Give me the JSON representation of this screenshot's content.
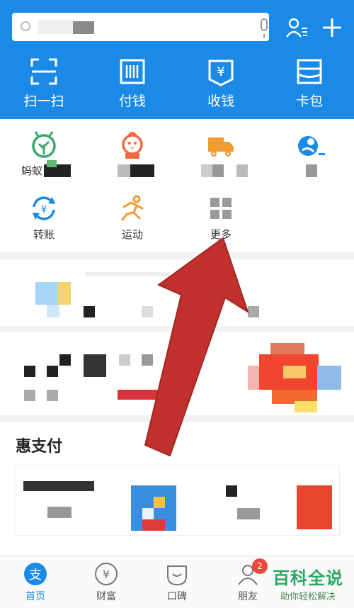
{
  "header": {
    "quick_actions": [
      {
        "label": "扫一扫",
        "icon": "scan-icon"
      },
      {
        "label": "付钱",
        "icon": "barcode-pay-icon"
      },
      {
        "label": "收钱",
        "icon": "receive-money-icon"
      },
      {
        "label": "卡包",
        "icon": "card-wallet-icon"
      }
    ]
  },
  "apps": {
    "row1": [
      {
        "label_partial": "蚂蚁",
        "icon": "ant-forest-icon"
      },
      {
        "label_partial": "",
        "icon": "chick-icon"
      },
      {
        "label_partial": "",
        "icon": "delivery-truck-icon"
      },
      {
        "label_partial": "",
        "icon": "blue-app-icon"
      }
    ],
    "row2": [
      {
        "label": "转账",
        "icon": "transfer-icon"
      },
      {
        "label": "运动",
        "icon": "running-icon"
      },
      {
        "label": "更多",
        "icon": "more-grid-icon"
      }
    ]
  },
  "section": {
    "hui_title": "惠支付"
  },
  "nav": {
    "items": [
      {
        "label": "首页",
        "icon": "home-pay-icon",
        "active": true
      },
      {
        "label": "财富",
        "icon": "wealth-icon",
        "active": false
      },
      {
        "label": "口碑",
        "icon": "koubei-icon",
        "active": false
      },
      {
        "label": "朋友",
        "icon": "friends-icon",
        "active": false
      }
    ],
    "badge": "2"
  },
  "watermark": {
    "line1": "百科全说",
    "line2": "助你轻松解决"
  },
  "colors": {
    "primary": "#1a8ae6",
    "arrow": "#c0302c",
    "green": "#2aa860"
  }
}
